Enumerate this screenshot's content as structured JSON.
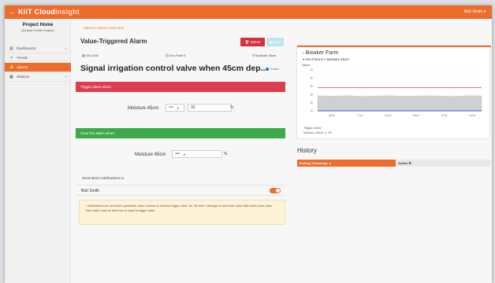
{
  "app": {
    "back_arrow": "←",
    "logo_kiit": "KiiT",
    "logo_cloud": "Cloud",
    "logo_insight": "Insight",
    "user_menu": "Bob Smith ▾"
  },
  "sidebar": {
    "project_title": "Project Home",
    "project_subtitle": "(Default Profile Project)",
    "items": [
      {
        "label": "Dashboards",
        "icon": "▤",
        "chevron": "›"
      },
      {
        "label": "Trends",
        "icon": "↗",
        "chevron": ""
      },
      {
        "label": "Alarms",
        "icon": "🔔",
        "chevron": ""
      },
      {
        "label": "Stations",
        "icon": "▦",
        "chevron": "›"
      }
    ]
  },
  "alarm": {
    "back_link": "‹ Back to Alarms Overview",
    "title": "Value-Triggered Alarm",
    "delete_label": "🗑 Delete",
    "save_label": "🖫 Save",
    "meta_device": "▥ GH-1000",
    "meta_point": "🛈 Gro-Point 6",
    "meta_sensor": "⚲ Moisture 45cm",
    "signal_title": "Signal irrigation control valve when 45cm dep...",
    "active_label": "Active"
  },
  "trigger": {
    "banner": "Trigger alarm when:",
    "label": "Moisture 45cm",
    "operator": "<=",
    "value": "32",
    "unit": "%"
  },
  "clear": {
    "banner": "Clear the alarm when:",
    "label": "Moisture 45cm",
    "operator": ">=",
    "value": "",
    "unit": "%"
  },
  "notifications": {
    "label": "Send alarm notifications to:",
    "recipient": "Bob Smith",
    "info_icon": "●",
    "info_text": "Notifications are sent when parameter value reaches or exceeds trigger value. An \"all clear\" message is sent when value falls below clear value. Clear value must be less than or equal to trigger value."
  },
  "chart_card": {
    "farm_title": "Bowker Farm",
    "sensor_path": "⌖ Gro-Point 6 > Moisture 45cm",
    "trigger_note_1": "Trigger when:",
    "trigger_note_2": "Moisture 45cm <= 32"
  },
  "chart_data": {
    "type": "line",
    "ylabel": "Value",
    "y_ticks": [
      "40",
      "35",
      "30",
      "25",
      "20",
      "15"
    ],
    "ylim": [
      15,
      45
    ],
    "x_ticks": [
      "06:00",
      "7 Jun",
      "04:00",
      "08:00",
      "12:00",
      "16:00"
    ],
    "trigger_line": 32,
    "series": [
      {
        "x": [
          0,
          1,
          2,
          3,
          4,
          5,
          6,
          7,
          8,
          9,
          10,
          11,
          12,
          13,
          14,
          15,
          16
        ],
        "values": [
          26.0,
          25.8,
          25.9,
          26.2,
          25.7,
          25.6,
          25.9,
          26.1,
          25.8,
          25.7,
          25.9,
          26.0,
          25.8,
          25.6,
          25.9,
          26.1,
          25.9
        ]
      }
    ],
    "colors": {
      "trigger": "#d64a4a",
      "series_fill": "#d0d0d0",
      "baseline": "#3a55c8"
    }
  },
  "history": {
    "title": "History",
    "col_timestamp": "Ending Timestamp ▲",
    "col_action": "Action ⇅"
  }
}
